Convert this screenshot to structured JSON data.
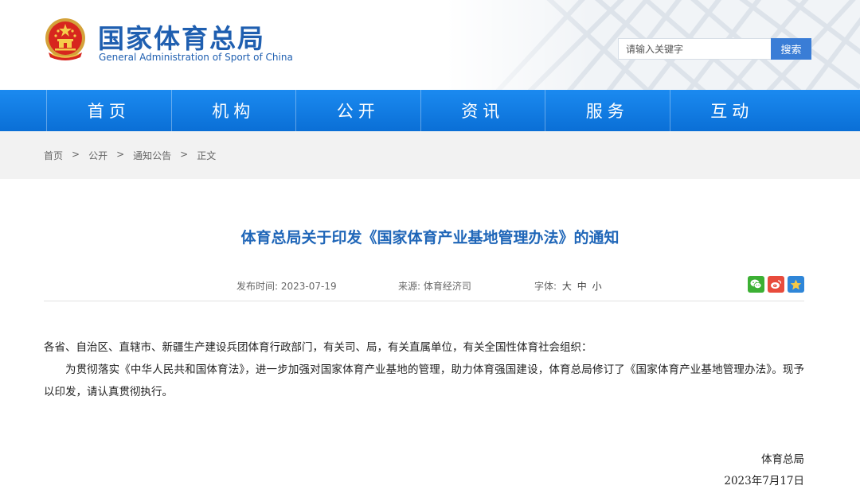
{
  "header": {
    "title_cn": "国家体育总局",
    "title_en": "General Administration of Sport of China",
    "search_placeholder": "请输入关键字",
    "search_button": "搜索"
  },
  "nav": {
    "items": [
      {
        "label": "首页"
      },
      {
        "label": "机构"
      },
      {
        "label": "公开"
      },
      {
        "label": "资讯"
      },
      {
        "label": "服务"
      },
      {
        "label": "互动"
      }
    ]
  },
  "breadcrumb": {
    "items": [
      "首页",
      "公开",
      "通知公告",
      "正文"
    ],
    "separator": ">"
  },
  "article": {
    "title": "体育总局关于印发《国家体育产业基地管理办法》的通知",
    "publish_label": "发布时间: 2023-07-19",
    "source_label": "来源: 体育经济司",
    "font_label": "字体:",
    "font_sizes": [
      "大",
      "中",
      "小"
    ],
    "paragraph_1": "各省、自治区、直辖市、新疆生产建设兵团体育行政部门，有关司、局，有关直属单位，有关全国性体育社会组织：",
    "paragraph_2": "为贯彻落实《中华人民共和国体育法》，进一步加强对国家体育产业基地的管理，助力体育强国建设，体育总局修订了《国家体育产业基地管理办法》。现予以印发，请认真贯彻执行。",
    "signature_org": "体育总局",
    "signature_date": "2023年7月17日"
  },
  "share": {
    "icons": [
      "wechat-icon",
      "weibo-icon",
      "favorite-icon"
    ]
  },
  "colors": {
    "brand_blue": "#1f5fb0",
    "nav_blue": "#0a6fd6",
    "title_blue": "#1f66b8",
    "search_button": "#3a7dd6"
  }
}
